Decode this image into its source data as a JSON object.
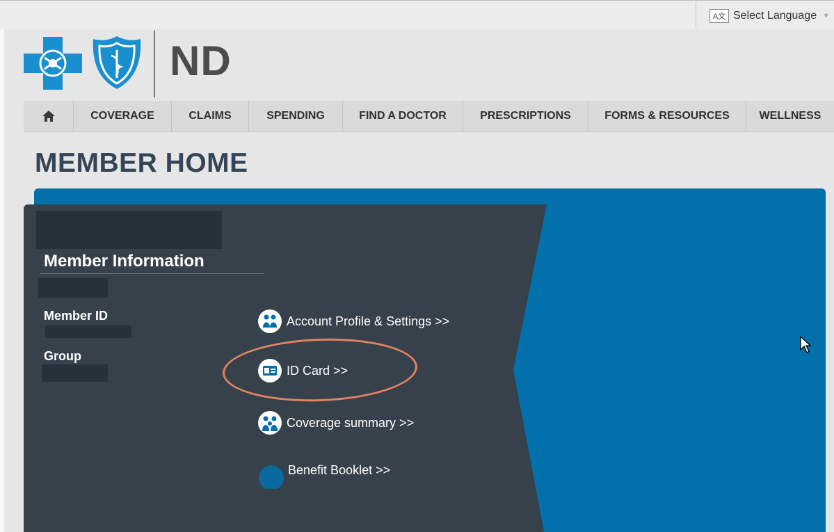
{
  "header": {
    "language_label": "Select Language",
    "language_icon_text": "A文",
    "brand_text": "ND"
  },
  "nav": {
    "home_icon": "home-icon",
    "items": [
      "COVERAGE",
      "CLAIMS",
      "SPENDING",
      "FIND A DOCTOR",
      "PRESCRIPTIONS",
      "FORMS & RESOURCES",
      "WELLNESS"
    ]
  },
  "page": {
    "title": "MEMBER HOME"
  },
  "member": {
    "section_title": "Member Information",
    "member_id_label": "Member ID",
    "group_label": "Group"
  },
  "links": [
    {
      "label": "Account Profile & Settings >>",
      "icon": "people-icon"
    },
    {
      "label": "ID Card >>",
      "icon": "id-card-icon"
    },
    {
      "label": "Coverage summary >>",
      "icon": "family-icon"
    },
    {
      "label": "Benefit Booklet >>",
      "icon": "booklet-icon"
    }
  ],
  "colors": {
    "brand_blue": "#0270aa",
    "dark_panel": "#36414b",
    "highlight": "#e0855e"
  }
}
